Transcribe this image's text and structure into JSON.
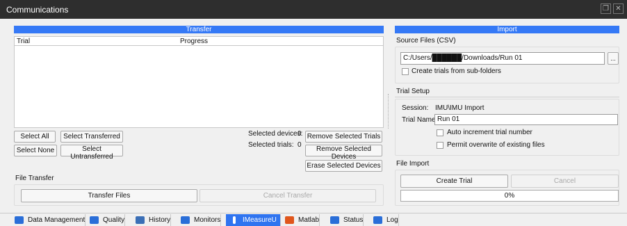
{
  "window": {
    "title": "Communications",
    "restore_icon": "restore-icon",
    "close_icon": "close-icon"
  },
  "transfer": {
    "header": "Transfer",
    "columns": [
      "Trial",
      "Progress"
    ],
    "rows": [],
    "buttons": {
      "select_all": "Select All",
      "select_transferred": "Select Transferred",
      "select_none": "Select None",
      "select_untransferred": "Select Untransferred",
      "remove_selected_trials": "Remove Selected Trials",
      "remove_selected_devices": "Remove Selected Devices",
      "erase_selected_devices": "Erase Selected Devices"
    },
    "selected_devices_label": "Selected devices:",
    "selected_devices_value": "0",
    "selected_trials_label": "Selected trials:",
    "selected_trials_value": "0"
  },
  "file_transfer": {
    "title": "File Transfer",
    "transfer_button": "Transfer Files",
    "cancel_button": "Cancel Transfer"
  },
  "import": {
    "header": "Import",
    "source_files_label": "Source Files (CSV)",
    "source_path": "C:/Users/██████/Downloads/Run 01",
    "browse_label": "...",
    "create_trials_label": "Create trials from sub-folders",
    "create_trials_checked": false
  },
  "trial_setup": {
    "title": "Trial Setup",
    "session_label": "Session:",
    "session_value": "IMU\\IMU Import",
    "trial_name_label": "Trial Name:",
    "trial_name_value": "Run 01",
    "auto_increment_label": "Auto increment trial number",
    "auto_increment_checked": false,
    "permit_overwrite_label": "Permit overwrite of existing files",
    "permit_overwrite_checked": false
  },
  "file_import": {
    "title": "File Import",
    "create_button": "Create Trial",
    "cancel_button": "Cancel",
    "progress_text": "0%",
    "progress_value": 0
  },
  "tabs": [
    {
      "label": "Data Management",
      "icon": "data-management-icon",
      "color": "#2a6ed8",
      "active": false
    },
    {
      "label": "Quality",
      "icon": "quality-icon",
      "color": "#2a6ed8",
      "active": false
    },
    {
      "label": "History",
      "icon": "history-icon",
      "color": "#3b6fb6",
      "active": false
    },
    {
      "label": "Monitors",
      "icon": "monitors-icon",
      "color": "#2a6ed8",
      "active": false
    },
    {
      "label": "IMeasureU",
      "icon": "imeasureu-icon",
      "color": "#ffffff",
      "active": true
    },
    {
      "label": "Matlab",
      "icon": "matlab-icon",
      "color": "#e0561c",
      "active": false
    },
    {
      "label": "Status",
      "icon": "status-icon",
      "color": "#2a6ed8",
      "active": false
    },
    {
      "label": "Log",
      "icon": "log-icon",
      "color": "#2a6ed8",
      "active": false
    }
  ],
  "colors": {
    "accent": "#3579f6",
    "titlebar": "#2e2e2e",
    "active_tab": "#2f74f0"
  }
}
